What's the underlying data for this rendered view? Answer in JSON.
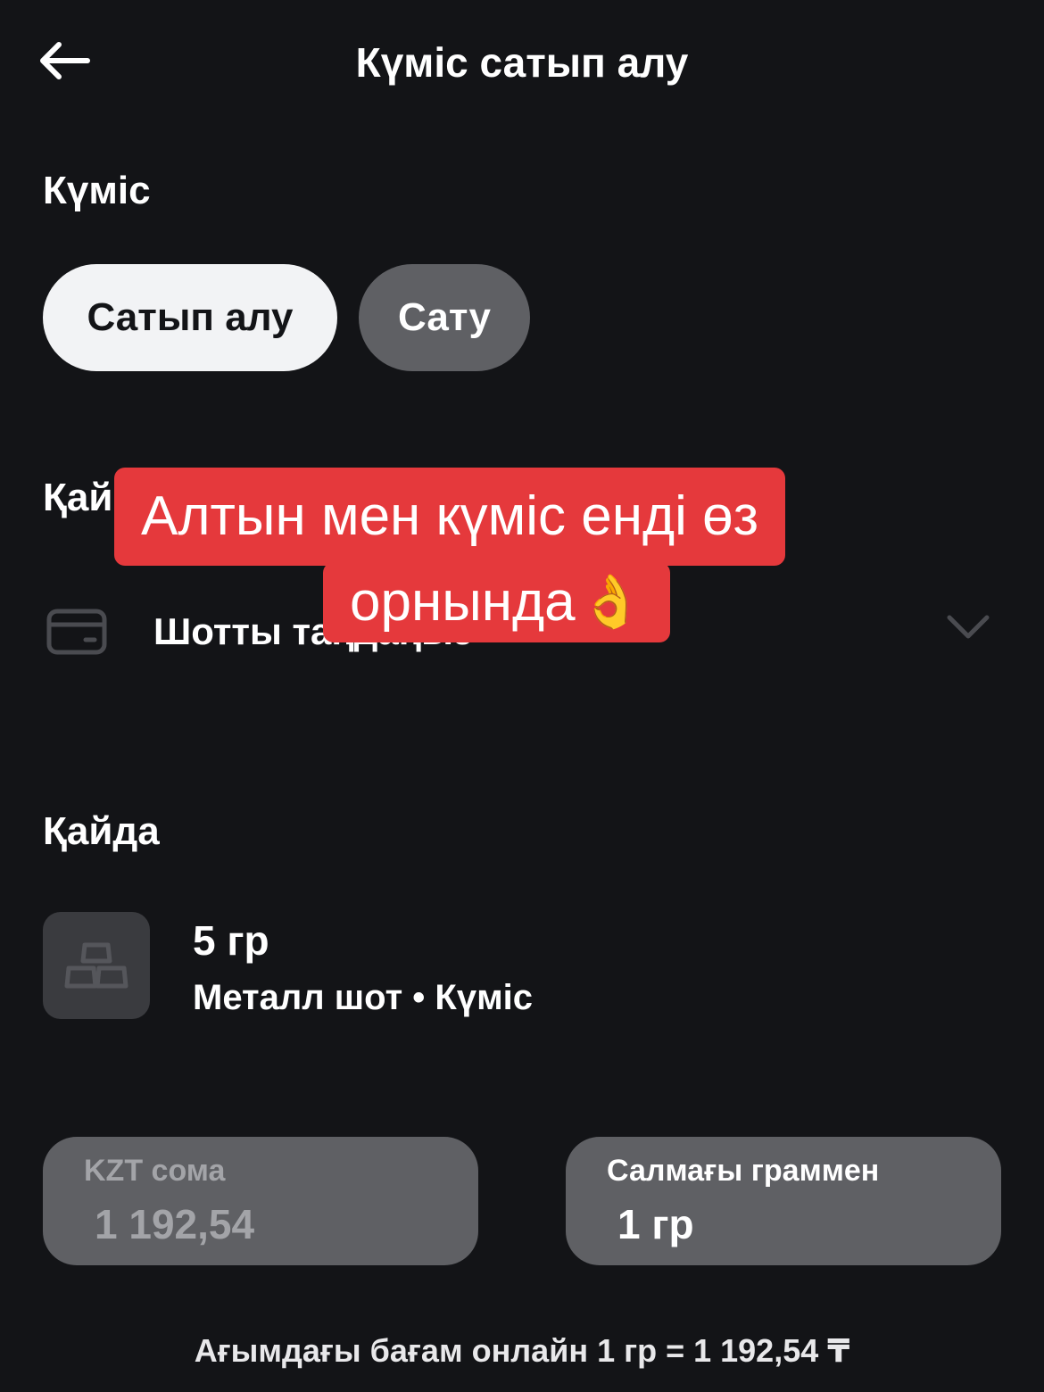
{
  "header": {
    "title": "Күміс сатып алу",
    "back_icon": "arrow-left-icon"
  },
  "metal": {
    "label": "Күміс",
    "tabs": [
      {
        "label": "Сатып алу",
        "selected": true
      },
      {
        "label": "Сату",
        "selected": false
      }
    ]
  },
  "source": {
    "label": "Қайдан",
    "label_visible": "Қай",
    "account_placeholder": "Шотты таңдаңыз",
    "account_icon": "card-icon",
    "chevron_icon": "chevron-down-icon"
  },
  "overlay": {
    "line1": "Алтын мен күміс енді өз",
    "line2": "орнында",
    "emoji": "👌"
  },
  "destination": {
    "label": "Қайда",
    "amount": "5 гр",
    "subtitle": "Металл шот • Күміс",
    "icon": "metal-bars-icon"
  },
  "inputs": {
    "kzt": {
      "label": "KZT сома",
      "value": "1 192,54"
    },
    "grams": {
      "label": "Салмағы граммен",
      "value": "1 гр"
    }
  },
  "rate": {
    "text": "Ағымдағы бағам онлайн 1 гр = 1 192,54 ₸"
  },
  "colors": {
    "background": "#131417",
    "pill_active": "#f2f3f5",
    "pill_inactive": "#5f6064",
    "overlay_red": "#e5393c",
    "tile": "#3a3b3f"
  }
}
